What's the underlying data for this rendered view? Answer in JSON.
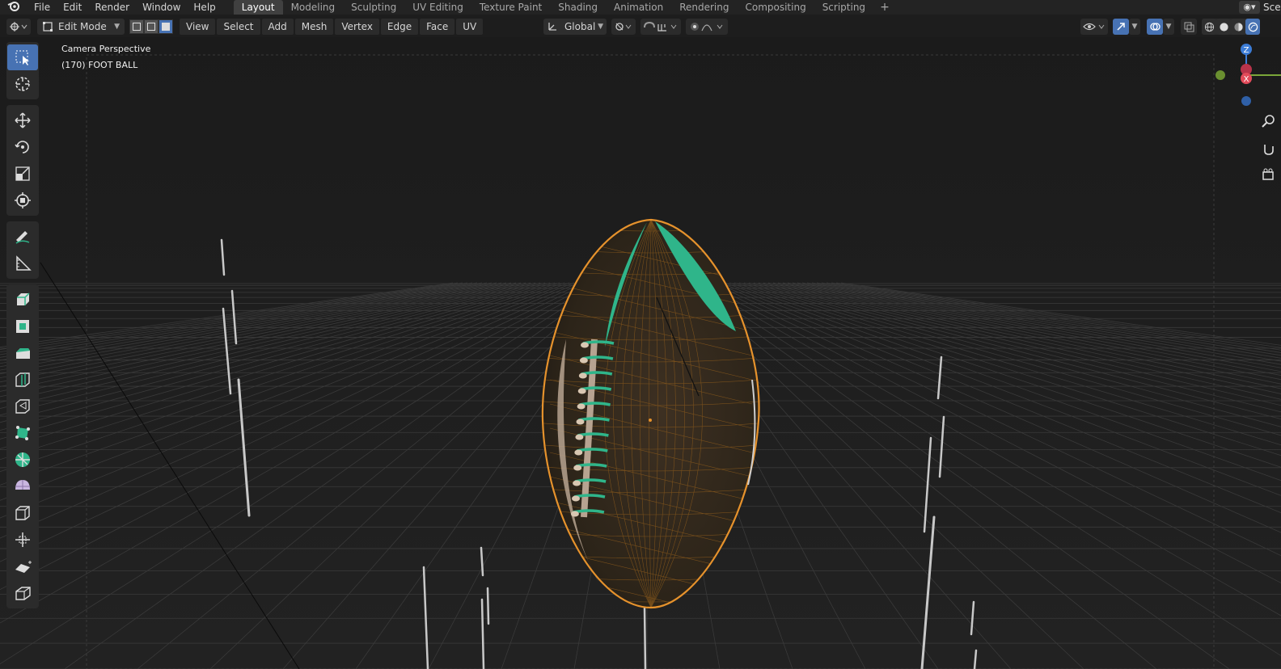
{
  "menu": {
    "items": [
      "File",
      "Edit",
      "Render",
      "Window",
      "Help"
    ]
  },
  "workspaces": {
    "tabs": [
      "Layout",
      "Modeling",
      "Sculpting",
      "UV Editing",
      "Texture Paint",
      "Shading",
      "Animation",
      "Rendering",
      "Compositing",
      "Scripting"
    ],
    "active": "Layout",
    "add_label": "+"
  },
  "scene": {
    "label": "Scen"
  },
  "header": {
    "mode": "Edit Mode",
    "menus": [
      "View",
      "Select",
      "Add",
      "Mesh",
      "Vertex",
      "Edge",
      "Face",
      "UV"
    ],
    "orientation": "Global"
  },
  "viewport": {
    "perspective_label": "Camera Perspective",
    "object_label": "(170) FOOT BALL"
  },
  "gizmo": {
    "z_label": "Z",
    "x_label": "X",
    "colors": {
      "x": "#e24b5a",
      "y": "#7ba639",
      "z": "#3c7cd6"
    }
  },
  "tools": [
    "select-box-icon",
    "cursor-icon",
    "move-icon",
    "rotate-icon",
    "scale-icon",
    "transform-icon",
    "annotate-icon",
    "measure-icon",
    "extrude-icon",
    "inset-icon",
    "bevel-icon",
    "loop-cut-icon",
    "knife-icon",
    "poly-build-icon",
    "spin-icon",
    "smooth-icon",
    "edge-slide-icon",
    "shrink-fatten-icon",
    "shear-icon",
    "rip-icon"
  ],
  "accent": {
    "active_blue": "#4772b3",
    "selection_orange": "#e6922c",
    "face_green": "#2fb58a"
  }
}
